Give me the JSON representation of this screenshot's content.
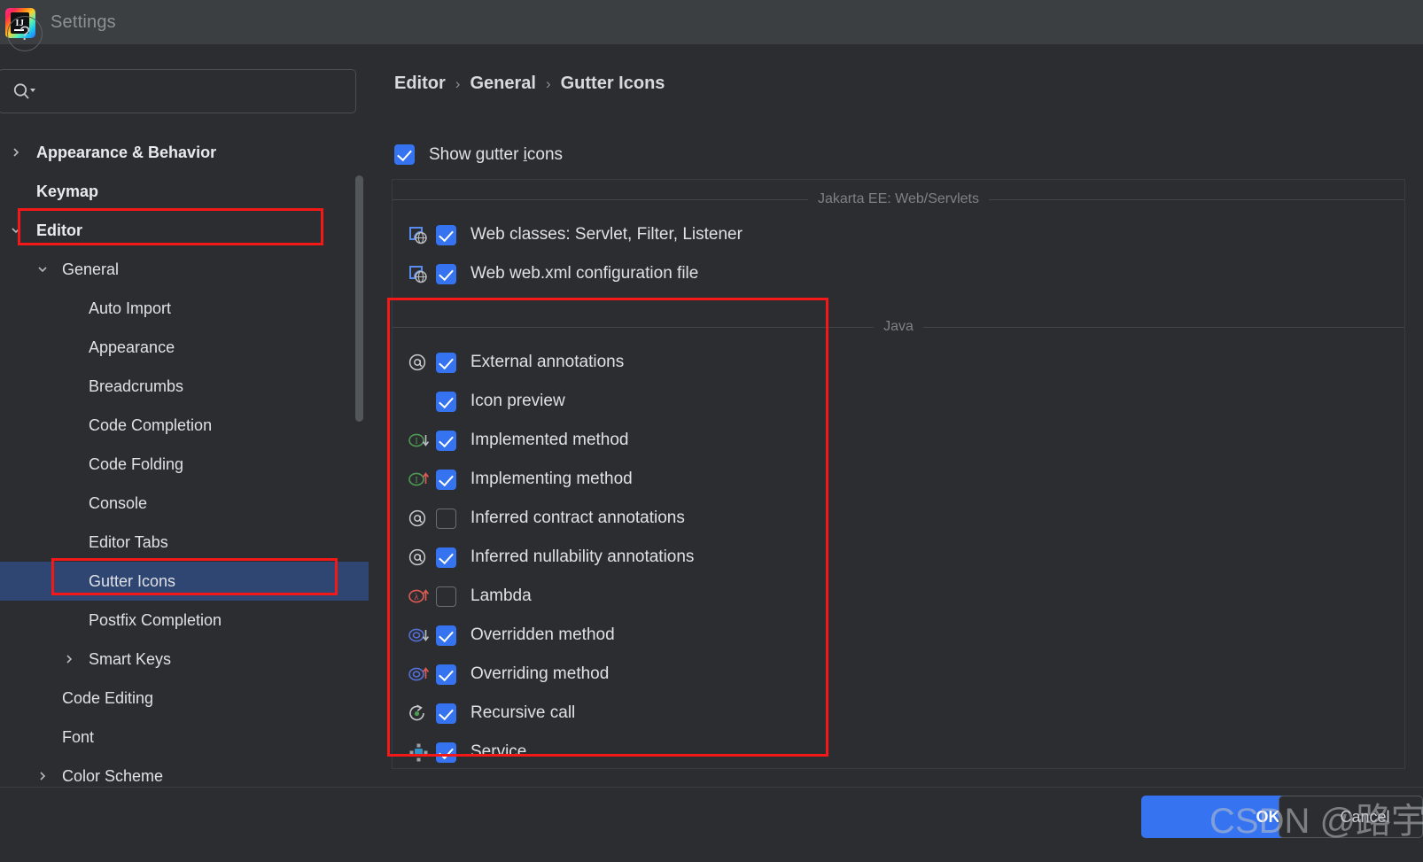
{
  "window": {
    "title": "Settings",
    "logo_text": "IJ"
  },
  "search": {
    "value": "",
    "placeholder": ""
  },
  "sidebar": {
    "items": [
      {
        "label": "Appearance & Behavior",
        "level": 0,
        "arrow": "right",
        "bold": true,
        "selected": false
      },
      {
        "label": "Keymap",
        "level": 0,
        "arrow": "none",
        "bold": true,
        "selected": false
      },
      {
        "label": "Editor",
        "level": 0,
        "arrow": "down",
        "bold": true,
        "selected": false
      },
      {
        "label": "General",
        "level": 1,
        "arrow": "down",
        "bold": false,
        "selected": false
      },
      {
        "label": "Auto Import",
        "level": 2,
        "arrow": "none",
        "bold": false,
        "selected": false
      },
      {
        "label": "Appearance",
        "level": 2,
        "arrow": "none",
        "bold": false,
        "selected": false
      },
      {
        "label": "Breadcrumbs",
        "level": 2,
        "arrow": "none",
        "bold": false,
        "selected": false
      },
      {
        "label": "Code Completion",
        "level": 2,
        "arrow": "none",
        "bold": false,
        "selected": false
      },
      {
        "label": "Code Folding",
        "level": 2,
        "arrow": "none",
        "bold": false,
        "selected": false
      },
      {
        "label": "Console",
        "level": 2,
        "arrow": "none",
        "bold": false,
        "selected": false
      },
      {
        "label": "Editor Tabs",
        "level": 2,
        "arrow": "none",
        "bold": false,
        "selected": false
      },
      {
        "label": "Gutter Icons",
        "level": 2,
        "arrow": "none",
        "bold": false,
        "selected": true
      },
      {
        "label": "Postfix Completion",
        "level": 2,
        "arrow": "none",
        "bold": false,
        "selected": false
      },
      {
        "label": "Smart Keys",
        "level": 2,
        "arrow": "right",
        "bold": false,
        "selected": false
      },
      {
        "label": "Code Editing",
        "level": 1,
        "arrow": "none",
        "bold": false,
        "selected": false
      },
      {
        "label": "Font",
        "level": 1,
        "arrow": "none",
        "bold": false,
        "selected": false
      },
      {
        "label": "Color Scheme",
        "level": 1,
        "arrow": "right",
        "bold": false,
        "selected": false
      }
    ]
  },
  "breadcrumb": {
    "items": [
      "Editor",
      "General",
      "Gutter Icons"
    ],
    "separator": "›"
  },
  "main": {
    "show_gutter_icons": {
      "label_before": "Show gutter ",
      "label_mnemonic": "i",
      "label_after": "cons",
      "checked": true
    },
    "sections": [
      {
        "title": "Jakarta EE: Web/Servlets",
        "options": [
          {
            "label": "Web classes: Servlet, Filter, Listener",
            "checked": true,
            "icon": "web-class-icon"
          },
          {
            "label": "Web web.xml configuration file",
            "checked": true,
            "icon": "web-xml-icon"
          }
        ]
      },
      {
        "title": "Java",
        "options": [
          {
            "label": "External annotations",
            "checked": true,
            "icon": "at-annotation-icon"
          },
          {
            "label": "Icon preview",
            "checked": true,
            "icon": "none"
          },
          {
            "label": "Implemented method",
            "checked": true,
            "icon": "implemented-method-icon"
          },
          {
            "label": "Implementing method",
            "checked": true,
            "icon": "implementing-method-icon"
          },
          {
            "label": "Inferred contract annotations",
            "checked": false,
            "icon": "at-annotation-icon"
          },
          {
            "label": "Inferred nullability annotations",
            "checked": true,
            "icon": "at-annotation-icon"
          },
          {
            "label": "Lambda",
            "checked": false,
            "icon": "lambda-icon"
          },
          {
            "label": "Overridden method",
            "checked": true,
            "icon": "overridden-method-icon"
          },
          {
            "label": "Overriding method",
            "checked": true,
            "icon": "overriding-method-icon"
          },
          {
            "label": "Recursive call",
            "checked": true,
            "icon": "recursive-call-icon"
          },
          {
            "label": "Service",
            "checked": true,
            "icon": "service-icon"
          }
        ]
      }
    ]
  },
  "bottom": {
    "help_label": "?",
    "ok_label": "OK",
    "cancel_label": "Cancel"
  },
  "watermark": {
    "text": "CSDN @路宇"
  },
  "colors": {
    "accent": "#3573f0",
    "selection": "#2f4673",
    "annotation": "#f51818",
    "panel_bg": "#2b2d30",
    "titlebar_bg": "#3c3f41"
  }
}
